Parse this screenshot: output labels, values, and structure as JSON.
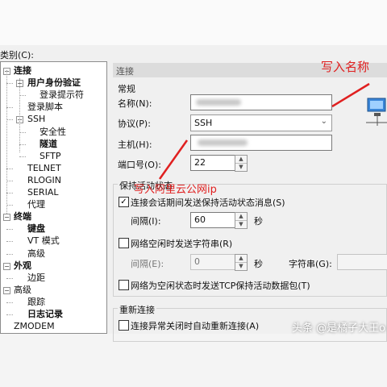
{
  "category_label": "类别(C):",
  "tree": [
    {
      "label": "连接",
      "bold": true,
      "level": 0,
      "toggle": "-"
    },
    {
      "label": "用户身份验证",
      "bold": true,
      "level": 1,
      "toggle": "-"
    },
    {
      "label": "登录提示符",
      "bold": false,
      "level": 2
    },
    {
      "label": "登录脚本",
      "bold": false,
      "level": 1
    },
    {
      "label": "SSH",
      "bold": false,
      "level": 1,
      "toggle": "-"
    },
    {
      "label": "安全性",
      "bold": false,
      "level": 2
    },
    {
      "label": "隧道",
      "bold": true,
      "level": 2
    },
    {
      "label": "SFTP",
      "bold": false,
      "level": 2
    },
    {
      "label": "TELNET",
      "bold": false,
      "level": 1
    },
    {
      "label": "RLOGIN",
      "bold": false,
      "level": 1
    },
    {
      "label": "SERIAL",
      "bold": false,
      "level": 1
    },
    {
      "label": "代理",
      "bold": false,
      "level": 1
    },
    {
      "label": "终端",
      "bold": true,
      "level": 0,
      "toggle": "-"
    },
    {
      "label": "键盘",
      "bold": true,
      "level": 1
    },
    {
      "label": "VT 模式",
      "bold": false,
      "level": 1
    },
    {
      "label": "高级",
      "bold": false,
      "level": 1
    },
    {
      "label": "外观",
      "bold": true,
      "level": 0,
      "toggle": "-"
    },
    {
      "label": "边距",
      "bold": false,
      "level": 1
    },
    {
      "label": "高级",
      "bold": false,
      "level": 0,
      "toggle": "-"
    },
    {
      "label": "跟踪",
      "bold": false,
      "level": 1
    },
    {
      "label": "日志记录",
      "bold": true,
      "level": 1
    },
    {
      "label": "ZMODEM",
      "bold": false,
      "level": 0
    }
  ],
  "panel": {
    "header": "连接",
    "general_title": "常规",
    "name_label": "名称(N):",
    "protocol_label": "协议(P):",
    "protocol_value": "SSH",
    "host_label": "主机(H):",
    "port_label": "端口号(O):",
    "port_value": "22",
    "keepalive_title": "保持活动状态",
    "keepalive_check_label": "连接会话期间发送保持活动状态消息(S)",
    "interval_label": "间隔(I):",
    "interval_value": "60",
    "seconds": "秒",
    "idle_check_label": "网络空闲时发送字符串(R)",
    "interval2_label": "间隔(E):",
    "interval2_value": "0",
    "string_label": "字符串(G):",
    "tcp_check_label": "网络为空闲状态时发送TCP保持活动数据包(T)",
    "reconnect_title": "重新连接",
    "reconnect_check_label": "连接异常关闭时自动重新连接(A)"
  },
  "annotations": {
    "write_name": "写入名称",
    "write_ip": "写入阿里云公网ip",
    "watermark": "头条 @是橘子大王o"
  },
  "colors": {
    "annotation_red": "#e02020",
    "panel_bg": "#f0f0f0"
  }
}
